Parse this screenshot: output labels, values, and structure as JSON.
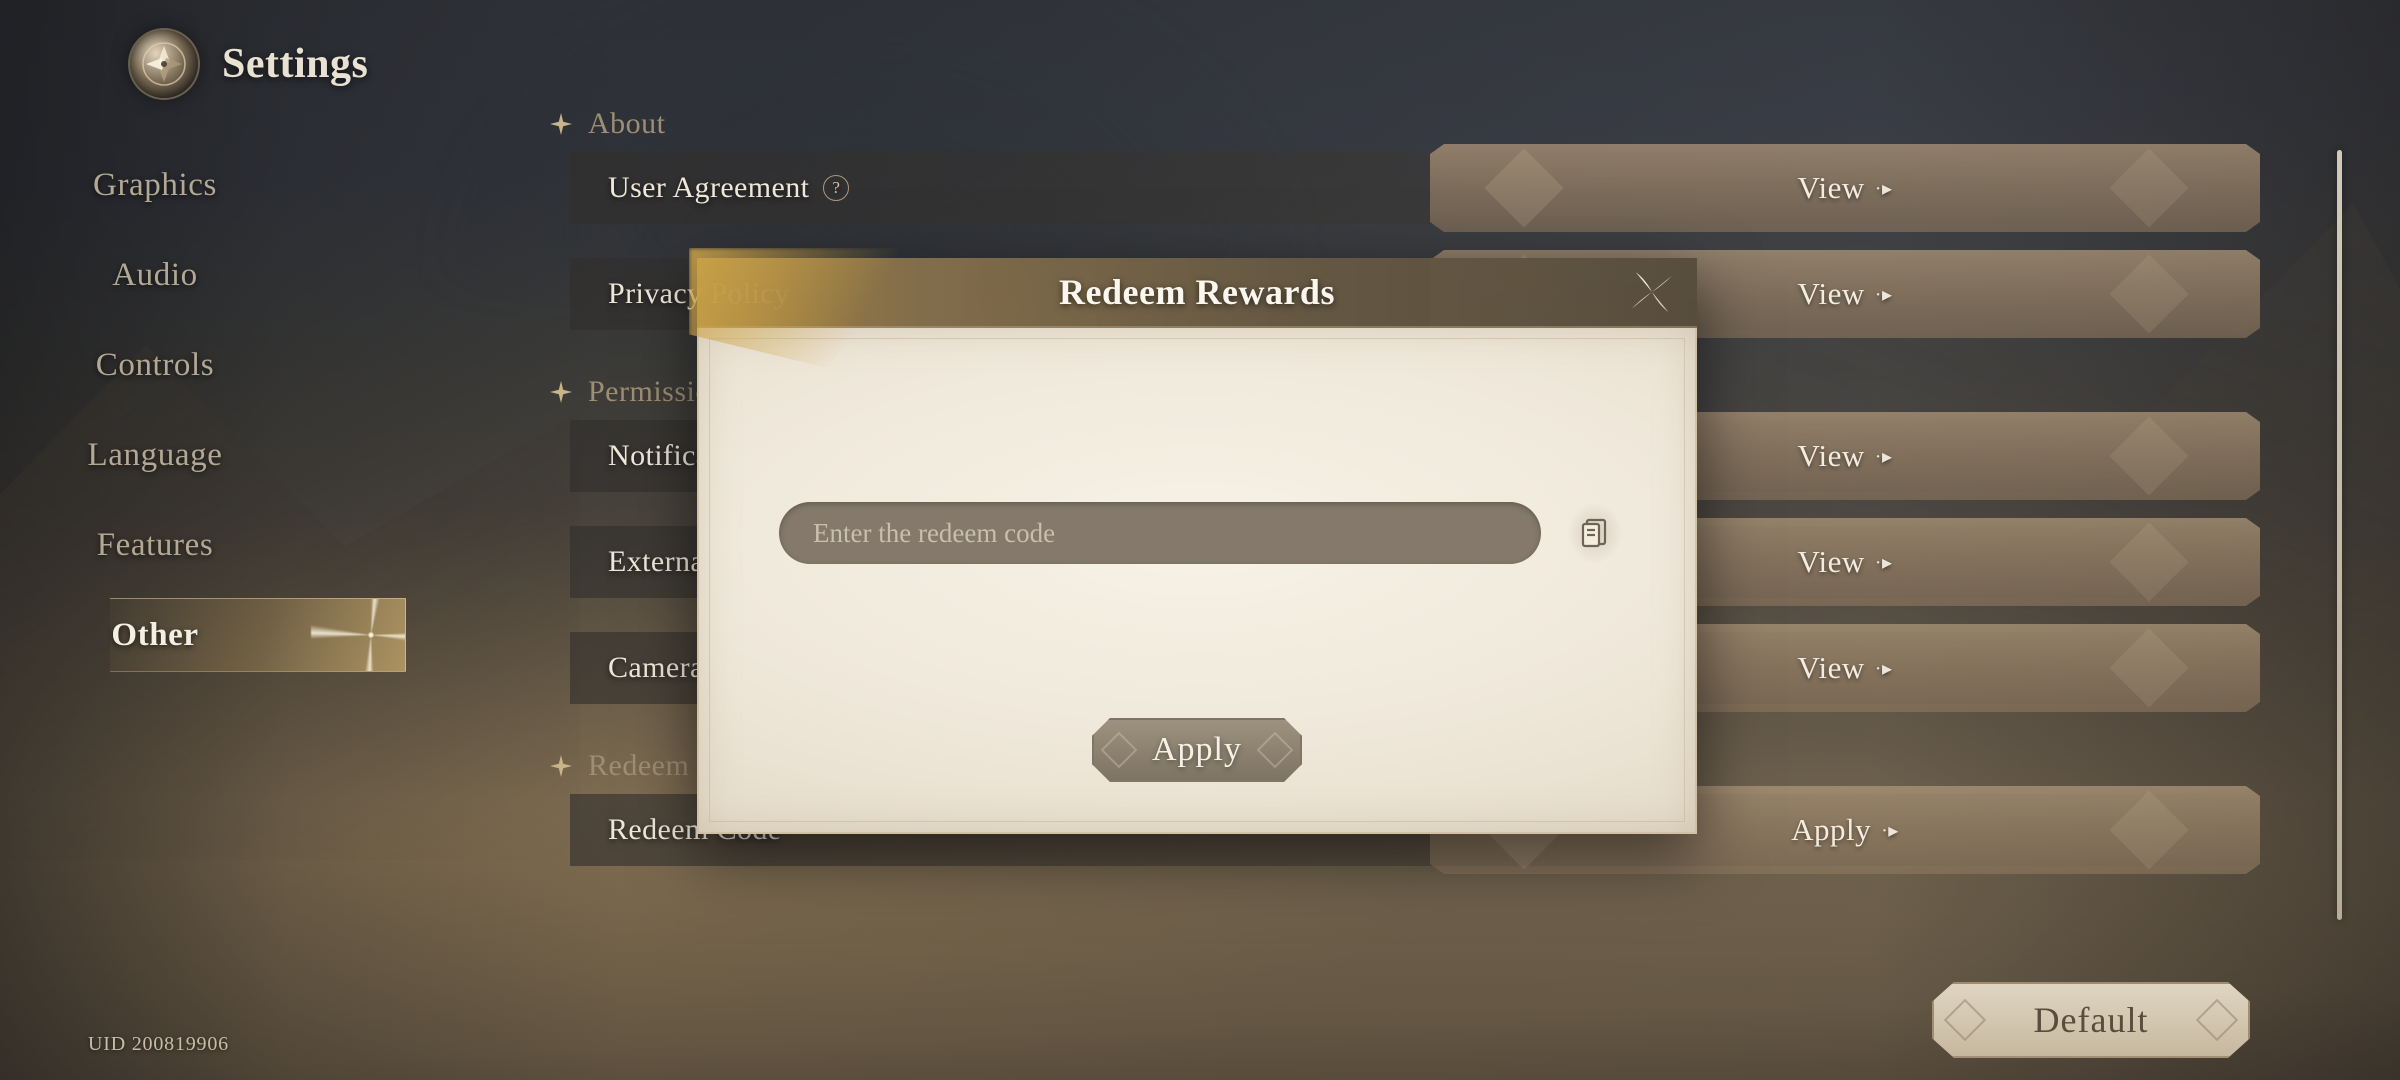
{
  "app": {
    "title": "Settings",
    "crest_icon": "compass-crest-icon"
  },
  "sidebar": {
    "items": [
      {
        "label": "Graphics",
        "active": false
      },
      {
        "label": "Audio",
        "active": false
      },
      {
        "label": "Controls",
        "active": false
      },
      {
        "label": "Language",
        "active": false
      },
      {
        "label": "Features",
        "active": false
      },
      {
        "label": "Other",
        "active": true
      }
    ]
  },
  "content": {
    "groups": [
      {
        "heading": "About",
        "rows": [
          {
            "label": "User Agreement",
            "help": "?",
            "action": "View",
            "action_arrow": "·▸"
          },
          {
            "label": "Privacy Policy",
            "help": "",
            "action": "View",
            "action_arrow": "·▸"
          }
        ]
      },
      {
        "heading": "Permissions",
        "rows": [
          {
            "label": "Notification Permissions",
            "help": "",
            "action": "View",
            "action_arrow": "·▸"
          },
          {
            "label": "External Storage Permissions",
            "help": "",
            "action": "View",
            "action_arrow": "·▸"
          },
          {
            "label": "Camera Permissions",
            "help": "",
            "action": "View",
            "action_arrow": "·▸"
          }
        ]
      },
      {
        "heading": "Redeem Code",
        "rows": [
          {
            "label": "Redeem Code",
            "help": "",
            "action": "Apply",
            "action_arrow": "·▸"
          }
        ]
      }
    ]
  },
  "footer": {
    "uid": "UID 200819906",
    "default_button": "Default"
  },
  "modal": {
    "title": "Redeem Rewards",
    "close_icon": "close-star-icon",
    "input": {
      "value": "",
      "placeholder": "Enter the redeem code"
    },
    "paste_icon": "clipboard-paste-icon",
    "apply_button": "Apply"
  },
  "colors": {
    "gold_accent": "#d0a64a",
    "parchment": "#f2ebdc",
    "plate_brown": "#a89073",
    "text_light": "#efe8da",
    "text_muted": "#9d8e74"
  }
}
